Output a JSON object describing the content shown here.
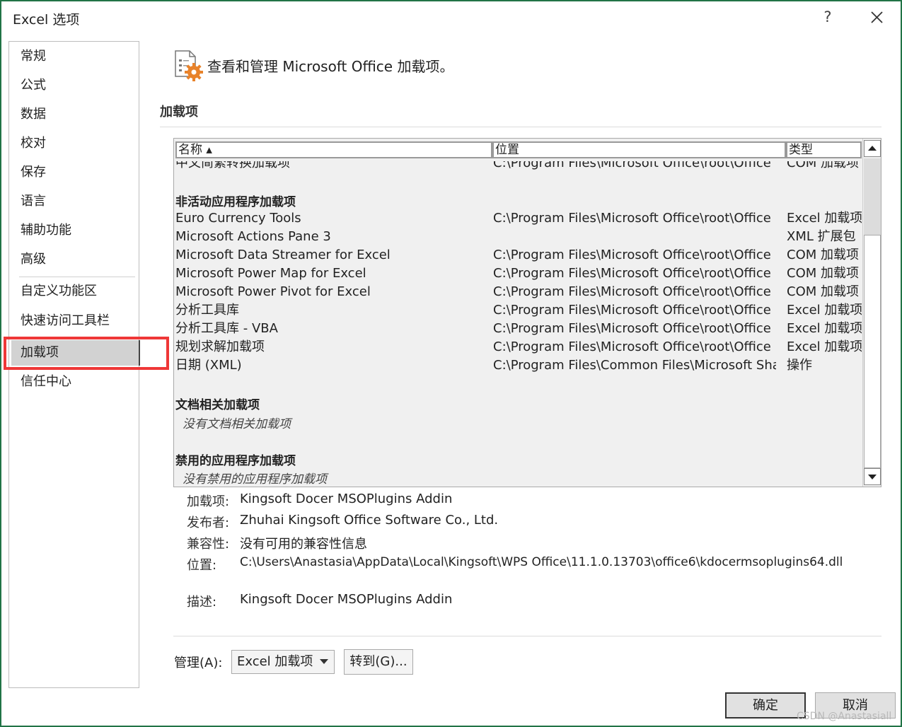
{
  "window": {
    "title": "Excel 选项",
    "help_label": "?"
  },
  "sidebar": {
    "items": [
      {
        "label": "常规"
      },
      {
        "label": "公式"
      },
      {
        "label": "数据"
      },
      {
        "label": "校对"
      },
      {
        "label": "保存"
      },
      {
        "label": "语言"
      },
      {
        "label": "辅助功能"
      },
      {
        "label": "高级"
      },
      {
        "label": "自定义功能区"
      },
      {
        "label": "快速访问工具栏"
      },
      {
        "label": "加载项"
      },
      {
        "label": "信任中心"
      }
    ],
    "selected": "加载项"
  },
  "header": {
    "text": "查看和管理 Microsoft Office 加载项。",
    "icon": "addins-gear-icon"
  },
  "section": {
    "title": "加载项"
  },
  "list": {
    "columns": [
      "名称 ▴",
      "位置",
      "类型"
    ],
    "partial_row": {
      "name": "中文简繁转换加载项",
      "location": "C:\\Program Files\\Microsoft Office\\root\\Office",
      "type": "COM 加载项"
    },
    "inactive_group": {
      "title": "非活动应用程序加载项",
      "rows": [
        {
          "name": "Euro Currency Tools",
          "location": "C:\\Program Files\\Microsoft Office\\root\\Office",
          "type": "Excel 加载项"
        },
        {
          "name": "Microsoft Actions Pane 3",
          "location": "",
          "type": "XML 扩展包"
        },
        {
          "name": "Microsoft Data Streamer for Excel",
          "location": "C:\\Program Files\\Microsoft Office\\root\\Office",
          "type": "COM 加载项"
        },
        {
          "name": "Microsoft Power Map for Excel",
          "location": "C:\\Program Files\\Microsoft Office\\root\\Office",
          "type": "COM 加载项"
        },
        {
          "name": "Microsoft Power Pivot for Excel",
          "location": "C:\\Program Files\\Microsoft Office\\root\\Office",
          "type": "COM 加载项"
        },
        {
          "name": "分析工具库",
          "location": "C:\\Program Files\\Microsoft Office\\root\\Office",
          "type": "Excel 加载项"
        },
        {
          "name": "分析工具库 - VBA",
          "location": "C:\\Program Files\\Microsoft Office\\root\\Office",
          "type": "Excel 加载项"
        },
        {
          "name": "规划求解加载项",
          "location": "C:\\Program Files\\Microsoft Office\\root\\Office",
          "type": "Excel 加载项"
        },
        {
          "name": "日期 (XML)",
          "location": "C:\\Program Files\\Common Files\\Microsoft Sha",
          "type": "操作"
        }
      ]
    },
    "document_group": {
      "title": "文档相关加载项",
      "empty": "没有文档相关加载项"
    },
    "disabled_group": {
      "title": "禁用的应用程序加载项",
      "empty": "没有禁用的应用程序加载项"
    }
  },
  "details": {
    "addin_label": "加载项:",
    "addin_value": "Kingsoft Docer MSOPlugins Addin",
    "publisher_label": "发布者:",
    "publisher_value": "Zhuhai Kingsoft Office Software Co., Ltd.",
    "compat_label": "兼容性:",
    "compat_value": "没有可用的兼容性信息",
    "location_label": "位置:",
    "location_value": "C:\\Users\\Anastasia\\AppData\\Local\\Kingsoft\\WPS Office\\11.1.0.13703\\office6\\kdocermsoplugins64.dll",
    "desc_label": "描述:",
    "desc_value": "Kingsoft Docer MSOPlugins Addin"
  },
  "manage": {
    "label": "管理(A):",
    "selected": "Excel 加载项",
    "goto_label": "转到(G)..."
  },
  "footer": {
    "ok_label": "确定",
    "cancel_label": "取消",
    "watermark": "CSDN @Anastasiall"
  },
  "colors": {
    "window_border": "#217346",
    "highlight": "#ef3737",
    "icon_orange": "#e8822a"
  }
}
